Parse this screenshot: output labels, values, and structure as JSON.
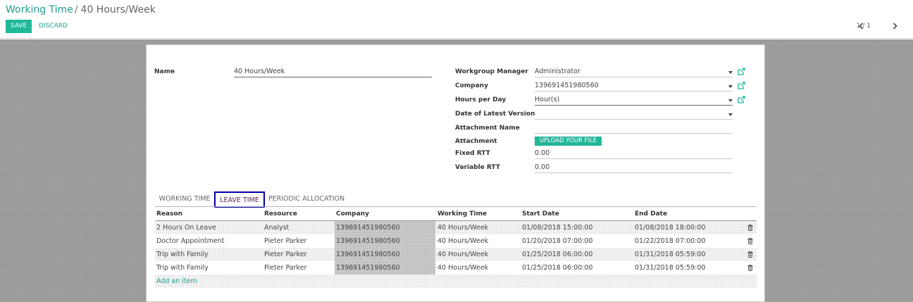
{
  "breadcrumb": {
    "parent": "Working Time",
    "separator": "/",
    "current": "40 Hours/Week"
  },
  "toolbar": {
    "save_label": "SAVE",
    "discard_label": "DISCARD"
  },
  "pager": {
    "value": "1 / 1"
  },
  "form": {
    "name_label": "Name",
    "name_value": "40 Hours/Week",
    "workgroup_manager_label": "Workgroup Manager",
    "workgroup_manager_value": "Administrator",
    "company_label": "Company",
    "company_value": "139691451980560",
    "hours_per_day_label": "Hours per Day",
    "hours_per_day_value": "Hour(s)",
    "date_latest_version_label": "Date of Latest Version",
    "date_latest_version_value": "",
    "attachment_name_label": "Attachment Name",
    "attachment_name_value": "",
    "attachment_label": "Attachment",
    "upload_label": "UPLOAD YOUR FILE",
    "fixed_rtt_label": "Fixed RTT",
    "fixed_rtt_value": "0.00",
    "variable_rtt_label": "Variable RTT",
    "variable_rtt_value": "0.00"
  },
  "tabs": [
    {
      "label": "WORKING TIME",
      "active": false
    },
    {
      "label": "LEAVE TIME",
      "active": true
    },
    {
      "label": "PERIODIC ALLOCATION",
      "active": false
    }
  ],
  "table": {
    "columns": [
      "Reason",
      "Resource",
      "Company",
      "Working Time",
      "Start Date",
      "End Date"
    ],
    "rows": [
      [
        "2 Hours On Leave",
        "Analyst",
        "139691451980560",
        "40 Hours/Week",
        "01/08/2018 15:00:00",
        "01/08/2018 18:00:00"
      ],
      [
        "Doctor Appointment",
        "Pieter Parker",
        "139691451980560",
        "40 Hours/Week",
        "01/20/2018 07:00:00",
        "01/22/2018 07:00:00"
      ],
      [
        "Trip with Family",
        "Pieter Parker",
        "139691451980560",
        "40 Hours/Week",
        "01/25/2018 06:00:00",
        "01/31/2018 05:59:00"
      ],
      [
        "Trip with Family",
        "Pieter Parker",
        "139691451980560",
        "40 Hours/Week",
        "01/25/2018 06:00:00",
        "01/31/2018 05:59:00"
      ]
    ],
    "add_item_label": "Add an item"
  },
  "icons": {
    "dropdown": "chevron-down-icon",
    "external_link": "external-link-icon",
    "delete": "trash-icon",
    "pager_prev": "chevron-left-icon",
    "pager_next": "chevron-right-icon"
  },
  "colors": {
    "accent": "#21b799",
    "link": "#21a08d",
    "active_tab_border": "#0000a8"
  }
}
